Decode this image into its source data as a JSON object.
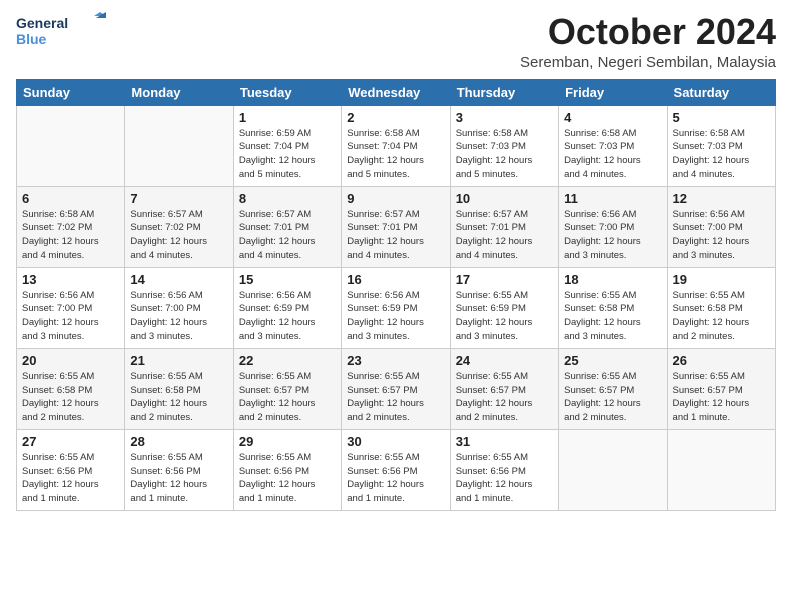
{
  "logo": {
    "text_general": "General",
    "text_blue": "Blue"
  },
  "title": "October 2024",
  "subtitle": "Seremban, Negeri Sembilan, Malaysia",
  "days_of_week": [
    "Sunday",
    "Monday",
    "Tuesday",
    "Wednesday",
    "Thursday",
    "Friday",
    "Saturday"
  ],
  "weeks": [
    [
      {
        "day": "",
        "info": ""
      },
      {
        "day": "",
        "info": ""
      },
      {
        "day": "1",
        "info": "Sunrise: 6:59 AM\nSunset: 7:04 PM\nDaylight: 12 hours\nand 5 minutes."
      },
      {
        "day": "2",
        "info": "Sunrise: 6:58 AM\nSunset: 7:04 PM\nDaylight: 12 hours\nand 5 minutes."
      },
      {
        "day": "3",
        "info": "Sunrise: 6:58 AM\nSunset: 7:03 PM\nDaylight: 12 hours\nand 5 minutes."
      },
      {
        "day": "4",
        "info": "Sunrise: 6:58 AM\nSunset: 7:03 PM\nDaylight: 12 hours\nand 4 minutes."
      },
      {
        "day": "5",
        "info": "Sunrise: 6:58 AM\nSunset: 7:03 PM\nDaylight: 12 hours\nand 4 minutes."
      }
    ],
    [
      {
        "day": "6",
        "info": "Sunrise: 6:58 AM\nSunset: 7:02 PM\nDaylight: 12 hours\nand 4 minutes."
      },
      {
        "day": "7",
        "info": "Sunrise: 6:57 AM\nSunset: 7:02 PM\nDaylight: 12 hours\nand 4 minutes."
      },
      {
        "day": "8",
        "info": "Sunrise: 6:57 AM\nSunset: 7:01 PM\nDaylight: 12 hours\nand 4 minutes."
      },
      {
        "day": "9",
        "info": "Sunrise: 6:57 AM\nSunset: 7:01 PM\nDaylight: 12 hours\nand 4 minutes."
      },
      {
        "day": "10",
        "info": "Sunrise: 6:57 AM\nSunset: 7:01 PM\nDaylight: 12 hours\nand 4 minutes."
      },
      {
        "day": "11",
        "info": "Sunrise: 6:56 AM\nSunset: 7:00 PM\nDaylight: 12 hours\nand 3 minutes."
      },
      {
        "day": "12",
        "info": "Sunrise: 6:56 AM\nSunset: 7:00 PM\nDaylight: 12 hours\nand 3 minutes."
      }
    ],
    [
      {
        "day": "13",
        "info": "Sunrise: 6:56 AM\nSunset: 7:00 PM\nDaylight: 12 hours\nand 3 minutes."
      },
      {
        "day": "14",
        "info": "Sunrise: 6:56 AM\nSunset: 7:00 PM\nDaylight: 12 hours\nand 3 minutes."
      },
      {
        "day": "15",
        "info": "Sunrise: 6:56 AM\nSunset: 6:59 PM\nDaylight: 12 hours\nand 3 minutes."
      },
      {
        "day": "16",
        "info": "Sunrise: 6:56 AM\nSunset: 6:59 PM\nDaylight: 12 hours\nand 3 minutes."
      },
      {
        "day": "17",
        "info": "Sunrise: 6:55 AM\nSunset: 6:59 PM\nDaylight: 12 hours\nand 3 minutes."
      },
      {
        "day": "18",
        "info": "Sunrise: 6:55 AM\nSunset: 6:58 PM\nDaylight: 12 hours\nand 3 minutes."
      },
      {
        "day": "19",
        "info": "Sunrise: 6:55 AM\nSunset: 6:58 PM\nDaylight: 12 hours\nand 2 minutes."
      }
    ],
    [
      {
        "day": "20",
        "info": "Sunrise: 6:55 AM\nSunset: 6:58 PM\nDaylight: 12 hours\nand 2 minutes."
      },
      {
        "day": "21",
        "info": "Sunrise: 6:55 AM\nSunset: 6:58 PM\nDaylight: 12 hours\nand 2 minutes."
      },
      {
        "day": "22",
        "info": "Sunrise: 6:55 AM\nSunset: 6:57 PM\nDaylight: 12 hours\nand 2 minutes."
      },
      {
        "day": "23",
        "info": "Sunrise: 6:55 AM\nSunset: 6:57 PM\nDaylight: 12 hours\nand 2 minutes."
      },
      {
        "day": "24",
        "info": "Sunrise: 6:55 AM\nSunset: 6:57 PM\nDaylight: 12 hours\nand 2 minutes."
      },
      {
        "day": "25",
        "info": "Sunrise: 6:55 AM\nSunset: 6:57 PM\nDaylight: 12 hours\nand 2 minutes."
      },
      {
        "day": "26",
        "info": "Sunrise: 6:55 AM\nSunset: 6:57 PM\nDaylight: 12 hours\nand 1 minute."
      }
    ],
    [
      {
        "day": "27",
        "info": "Sunrise: 6:55 AM\nSunset: 6:56 PM\nDaylight: 12 hours\nand 1 minute."
      },
      {
        "day": "28",
        "info": "Sunrise: 6:55 AM\nSunset: 6:56 PM\nDaylight: 12 hours\nand 1 minute."
      },
      {
        "day": "29",
        "info": "Sunrise: 6:55 AM\nSunset: 6:56 PM\nDaylight: 12 hours\nand 1 minute."
      },
      {
        "day": "30",
        "info": "Sunrise: 6:55 AM\nSunset: 6:56 PM\nDaylight: 12 hours\nand 1 minute."
      },
      {
        "day": "31",
        "info": "Sunrise: 6:55 AM\nSunset: 6:56 PM\nDaylight: 12 hours\nand 1 minute."
      },
      {
        "day": "",
        "info": ""
      },
      {
        "day": "",
        "info": ""
      }
    ]
  ]
}
